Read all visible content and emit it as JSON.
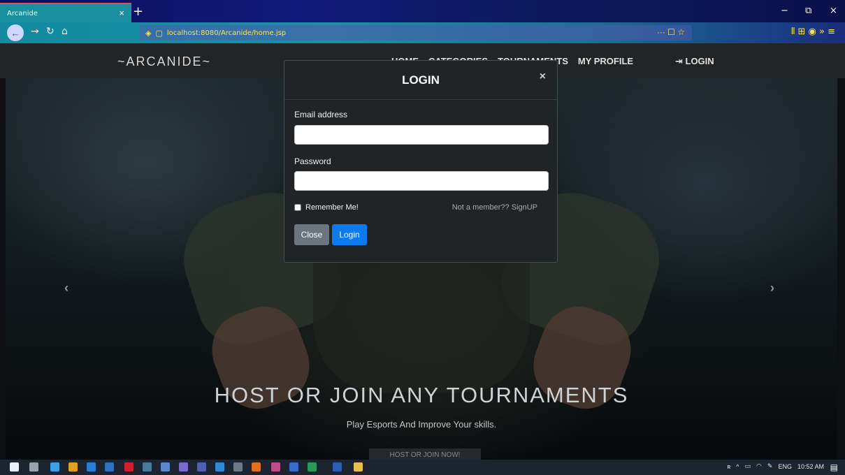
{
  "browser": {
    "tab_title": "Arcanide",
    "tab_close": "×",
    "new_tab": "+",
    "url": "localhost:8080/Arcanide/home.jsp",
    "url_actions": "··· ☐ ☆",
    "toolbar_icons": "⫴ ⊞ ◉ » ≡",
    "win_min": "−",
    "win_restore": "⧉",
    "win_close": "×"
  },
  "site": {
    "brand": "~ARCANIDE~",
    "menu": [
      "HOME",
      "CATEGORIES",
      "TOURNAMENTS",
      "MY PROFILE"
    ],
    "login_link": "⇥ LOGIN"
  },
  "hero": {
    "title": "HOST OR JOIN ANY TOURNAMENTS",
    "subtitle": "Play Esports And Improve Your skills.",
    "cta": "HOST OR JOIN NOW!",
    "prev": "‹",
    "next": "›"
  },
  "modal": {
    "title": "LOGIN",
    "close_icon": "×",
    "email_label": "Email address",
    "email_value": "",
    "password_label": "Password",
    "password_value": "",
    "remember_label": "Remember Me!",
    "signup_text": "Not a member?? SignUP",
    "close_button": "Close",
    "login_button": "Login"
  },
  "taskbar": {
    "language": "ENG",
    "time": "10:52 AM"
  }
}
